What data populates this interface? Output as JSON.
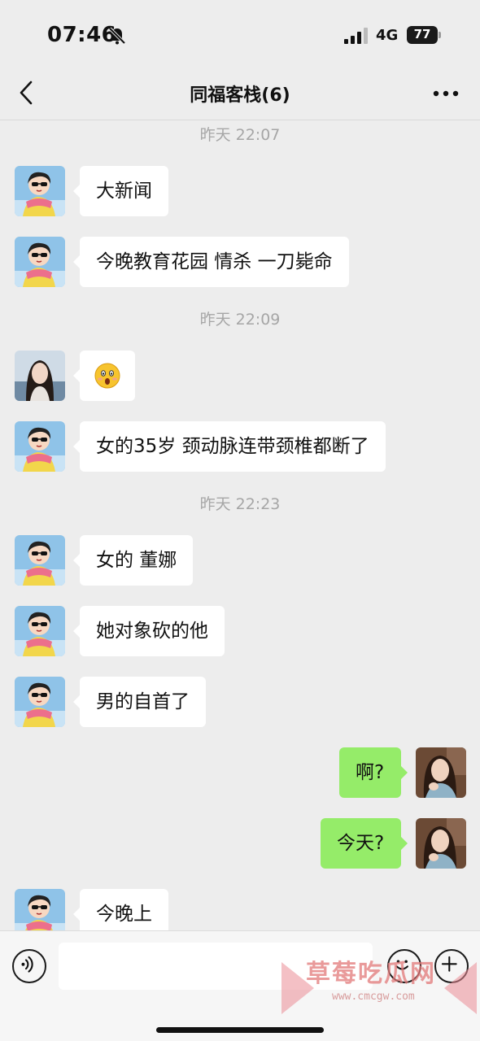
{
  "status_bar": {
    "time": "07:46",
    "network": "4G",
    "battery": "77"
  },
  "nav": {
    "title": "同福客栈(6)"
  },
  "messages": [
    {
      "type": "time",
      "text": "昨天 22:07"
    },
    {
      "type": "msg",
      "side": "left",
      "sender": "cartoon",
      "text": "大新闻"
    },
    {
      "type": "msg",
      "side": "left",
      "sender": "cartoon",
      "text": "今晚教育花园 情杀 一刀毙命"
    },
    {
      "type": "time",
      "text": "昨天 22:09"
    },
    {
      "type": "msg",
      "side": "left",
      "sender": "woman",
      "emoji": "astonished-face-icon"
    },
    {
      "type": "msg",
      "side": "left",
      "sender": "cartoon",
      "text": "女的35岁 颈动脉连带颈椎都断了"
    },
    {
      "type": "time",
      "text": "昨天 22:23"
    },
    {
      "type": "msg",
      "side": "left",
      "sender": "cartoon",
      "text": "女的 董娜"
    },
    {
      "type": "msg",
      "side": "left",
      "sender": "cartoon",
      "text": "她对象砍的他"
    },
    {
      "type": "msg",
      "side": "left",
      "sender": "cartoon",
      "text": "男的自首了"
    },
    {
      "type": "msg",
      "side": "right",
      "sender": "self",
      "text": "啊?"
    },
    {
      "type": "msg",
      "side": "right",
      "sender": "self",
      "text": "今天?"
    },
    {
      "type": "msg",
      "side": "left",
      "sender": "cartoon",
      "text": "今晚上"
    }
  ],
  "input_bar": {
    "icons": [
      "voice-icon",
      "emoji-icon",
      "plus-icon"
    ]
  },
  "watermark": {
    "text": "草莓吃瓜网",
    "url": "www.cmcgw.com"
  },
  "colors": {
    "background": "#ededed",
    "bubble_left": "#ffffff",
    "bubble_right": "#95ec69",
    "timestamp": "#a6a6a6"
  }
}
